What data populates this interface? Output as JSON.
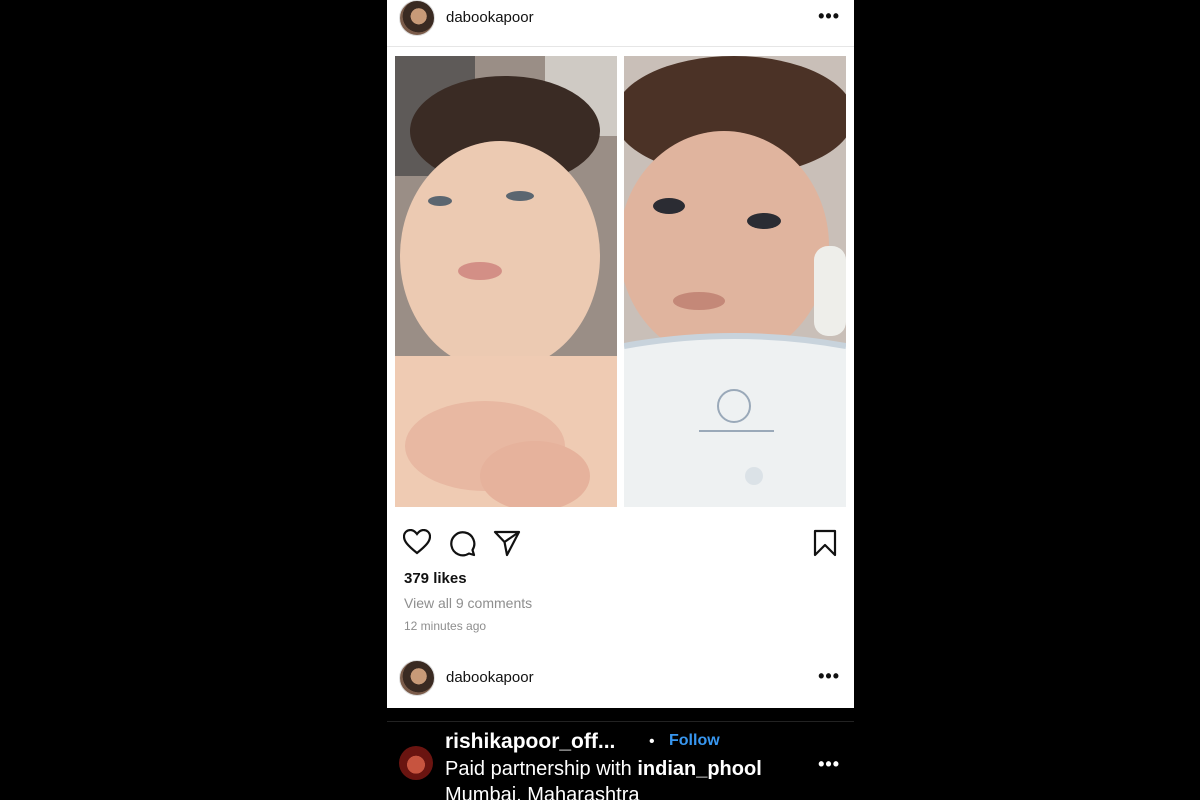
{
  "post": {
    "username": "dabookapoor",
    "more_icon": "more-horizontal-icon",
    "likes": "379 likes",
    "view_comments": "View all 9 comments",
    "timestamp": "12 minutes ago",
    "actions": [
      "heart-icon",
      "comment-icon",
      "share-icon",
      "bookmark-icon"
    ]
  },
  "comment_row": {
    "username": "dabookapoor"
  },
  "next_post": {
    "username": "rishikapoor_off...",
    "separator": "•",
    "follow_label": "Follow",
    "paid_prefix": "Paid partnership with ",
    "partner": "indian_phool",
    "location": "Mumbai, Maharashtra"
  },
  "colors": {
    "follow": "#3897f0",
    "secondary_text": "#8e8e8e",
    "background": "#000000"
  }
}
